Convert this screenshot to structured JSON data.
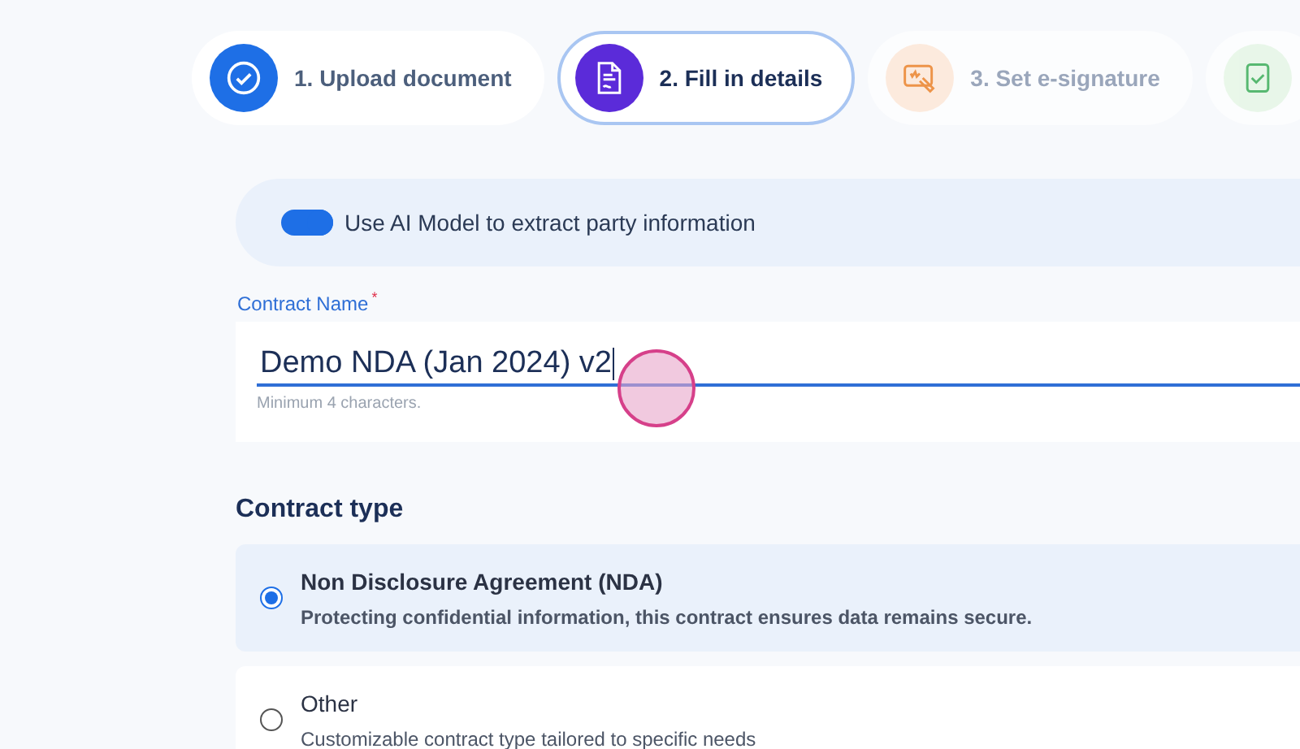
{
  "steps": [
    {
      "kind": "upload",
      "label": "1. Upload document",
      "completed": true,
      "selected": false
    },
    {
      "kind": "details",
      "label": "2. Fill in details",
      "completed": false,
      "selected": true
    },
    {
      "kind": "signature",
      "label": "3. Set e-signature",
      "completed": false,
      "selected": false
    },
    {
      "kind": "review",
      "selected": false
    }
  ],
  "ai_toggle": {
    "label": "Use AI Model to extract party information",
    "on": true
  },
  "contract_name": {
    "label": "Contract Name",
    "required_mark": "*",
    "value": "Demo NDA (Jan 2024) v2",
    "hint": "Minimum 4 characters."
  },
  "contract_type": {
    "heading": "Contract type",
    "options": [
      {
        "title": "Non Disclosure Agreement (NDA)",
        "description": "Protecting confidential information, this contract ensures data remains secure.",
        "selected": true
      },
      {
        "title": "Other",
        "description": "Customizable contract type tailored to specific needs",
        "selected": false
      }
    ]
  }
}
